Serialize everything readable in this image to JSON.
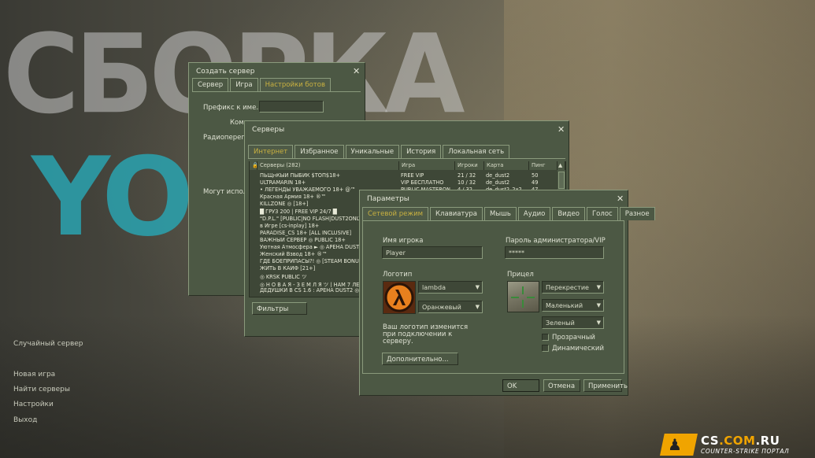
{
  "background": {
    "big_word_1": "СБОРКА",
    "big_word_2": "YOI"
  },
  "main_menu": {
    "random_server": "Случайный сервер",
    "new_game": "Новая игра",
    "find_servers": "Найти серверы",
    "settings": "Настройки",
    "exit": "Выход"
  },
  "create_server": {
    "title": "Создать сервер",
    "tabs": [
      "Сервер",
      "Игра",
      "Настройки ботов"
    ],
    "active_tab": "Настройки ботов",
    "prefix_label": "Префикс к име...",
    "command_label": "Кома",
    "radio_label": "Радиоперегов",
    "can_use_label": "Могут исполь"
  },
  "servers": {
    "title": "Серверы",
    "tabs": [
      "Интернет",
      "Избранное",
      "Уникальные",
      "История",
      "Локальная сеть"
    ],
    "active_tab": "Интернет",
    "columns": {
      "name": "Серверы (282)",
      "game": "Игра",
      "players": "Игроки",
      "map": "Карта",
      "ping": "Пинг"
    },
    "rows": [
      {
        "name": "ПЬЩнКЫЙ ПЫБИК $ТОП$18+",
        "game": "FREE VIP",
        "players": "21 / 32",
        "map": "de_dust2",
        "ping": "50"
      },
      {
        "name": "ULTRAMARIN 18+",
        "game": "VIP БЕСПЛАТНО",
        "players": "10 / 32",
        "map": "de_dust2",
        "ping": "49"
      },
      {
        "name": "• ЛЕГЕНДЫ УВАЖАЕМОГО 18+ @™",
        "game": "PUBLIC MASTERON",
        "players": "4 / 32",
        "map": "de_dust2_2x2",
        "ping": "47"
      },
      {
        "name": "Красная Армия 18+ ®™",
        "game": "",
        "players": "",
        "map": "",
        "ping": ""
      },
      {
        "name": "KILLZONE ◎ [18+]",
        "game": "",
        "players": "",
        "map": "",
        "ping": ""
      },
      {
        "name": "█ ГРУЗ 200 | FREE VIP 24/7 █",
        "game": "",
        "players": "",
        "map": "",
        "ping": ""
      },
      {
        "name": "\"D.P.L.\" [PUBLIC|NO FLASH|DUST2ONLY]",
        "game": "",
        "players": "",
        "map": "",
        "ping": ""
      },
      {
        "name": "в Игре [cs-inplay] 18+",
        "game": "",
        "players": "",
        "map": "",
        "ping": ""
      },
      {
        "name": "PARADISE_CS 18+ [ALL INCLUSIVE]",
        "game": "",
        "players": "",
        "map": "",
        "ping": ""
      },
      {
        "name": "ВАЖНЫЙ СЕРВЕР ◎ PUBLIC 18+",
        "game": "",
        "players": "",
        "map": "",
        "ping": ""
      },
      {
        "name": "Уютная Атмосфера ► ◎ АРЕНА DUST2",
        "game": "",
        "players": "",
        "map": "",
        "ping": ""
      },
      {
        "name": "Женский Взвод 18+ ®™",
        "game": "",
        "players": "",
        "map": "",
        "ping": ""
      },
      {
        "name": "ГДЕ БОЕПРИПАСЫ?! ◎ [STEAM BONUS]",
        "game": "",
        "players": "",
        "map": "",
        "ping": ""
      },
      {
        "name": "ЖИТЬ В КАЙФ [21+]",
        "game": "",
        "players": "",
        "map": "",
        "ping": ""
      },
      {
        "name": "◎ KRSK PUBLIC ツ",
        "game": "",
        "players": "",
        "map": "",
        "ping": ""
      },
      {
        "name": "◎ Н О В А Я - З Е М Л Я ツ | НАМ 7 ЛЕТ",
        "game": "",
        "players": "",
        "map": "",
        "ping": ""
      },
      {
        "name": "ДЕДУШКИ В CS 1.6 : АРЕНА DUST2 ◎™",
        "game": "",
        "players": "",
        "map": "",
        "ping": ""
      }
    ],
    "filters_button": "Фильтры"
  },
  "options": {
    "title": "Параметры",
    "tabs": [
      "Сетевой режим",
      "Клавиатура",
      "Мышь",
      "Аудио",
      "Видео",
      "Голос",
      "Разное"
    ],
    "active_tab": "Сетевой режим",
    "player_name_label": "Имя игрока",
    "player_name_value": "Player",
    "admin_password_label": "Пароль администратора/VIP",
    "admin_password_value": "*****",
    "logo_label": "Логотип",
    "logo_select": "lambda",
    "logo_color_select": "Оранжевый",
    "logo_note": "Ваш логотип изменится при подключении к серверу.",
    "advanced_button": "Дополнительно...",
    "crosshair_label": "Прицел",
    "crosshair_style": "Перекрестие",
    "crosshair_size": "Маленький",
    "crosshair_color": "Зеленый",
    "translucent_label": "Прозрачный",
    "dynamic_label": "Динамический",
    "ok_button": "OK",
    "cancel_button": "Отмена",
    "apply_button": "Применить"
  },
  "watermark": {
    "title_main": "CS",
    "title_accent": ".COM",
    "title_end": ".RU",
    "subtitle": "COUNTER-STRIKE ПОРТАЛ"
  },
  "colors": {
    "window_bg": "#4c5844",
    "active_tab_text": "#c9b140",
    "accent_logo": "#f0a400"
  }
}
